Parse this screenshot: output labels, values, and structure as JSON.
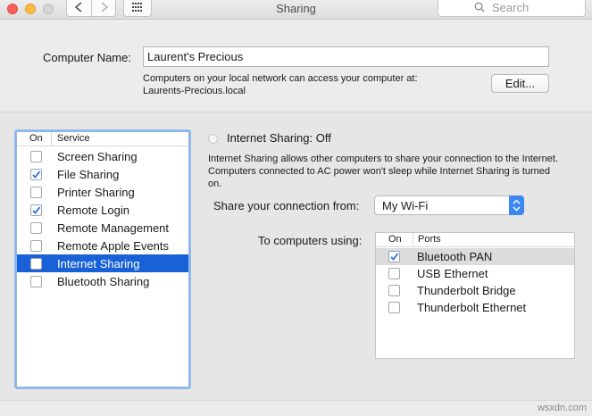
{
  "window": {
    "title": "Sharing",
    "search_placeholder": "Search"
  },
  "computer_name": {
    "label": "Computer Name:",
    "value": "Laurent's Precious",
    "info_line1": "Computers on your local network can access your computer at:",
    "info_line2": "Laurents-Precious.local",
    "edit_label": "Edit..."
  },
  "services": {
    "col_on": "On",
    "col_service": "Service",
    "items": [
      {
        "label": "Screen Sharing",
        "checked": false
      },
      {
        "label": "File Sharing",
        "checked": true
      },
      {
        "label": "Printer Sharing",
        "checked": false
      },
      {
        "label": "Remote Login",
        "checked": true
      },
      {
        "label": "Remote Management",
        "checked": false
      },
      {
        "label": "Remote Apple Events",
        "checked": false
      },
      {
        "label": "Internet Sharing",
        "checked": false,
        "selected": true
      },
      {
        "label": "Bluetooth Sharing",
        "checked": false
      }
    ]
  },
  "internet_sharing": {
    "status_title": "Internet Sharing: Off",
    "description": "Internet Sharing allows other computers to share your connection to the Internet. Computers connected to AC power won't sleep while Internet Sharing is turned on.",
    "share_from_label": "Share your connection from:",
    "share_from_value": "My Wi-Fi",
    "to_computers_label": "To computers using:",
    "ports_col_on": "On",
    "ports_col_ports": "Ports",
    "ports": [
      {
        "label": "Bluetooth PAN",
        "checked": true,
        "highlighted": true
      },
      {
        "label": "USB Ethernet",
        "checked": false
      },
      {
        "label": "Thunderbolt Bridge",
        "checked": false
      },
      {
        "label": "Thunderbolt Ethernet",
        "checked": false
      }
    ]
  },
  "watermark": "wsxdn.com",
  "colors": {
    "selection": "#1861d6",
    "focus_ring": "#8fb9ea",
    "checkmark": "#2b6fe0"
  }
}
